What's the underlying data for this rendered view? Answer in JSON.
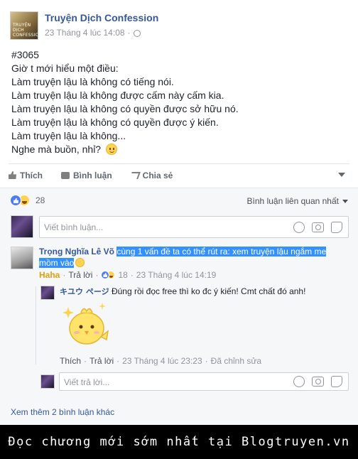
{
  "post": {
    "page_name": "Truyện Dịch Confession",
    "logo_text": "TRUYỆN DỊCH CONFESSION",
    "timestamp": "23 Tháng 4 lúc 14:08",
    "separator": "·",
    "lines": [
      "#3065",
      "Giờ t mới hiểu một điều:",
      "Làm truyện lậu là không có tiếng nói.",
      "Làm truyện lậu là không được cấm này cấm kia.",
      "Làm truyện lậu là không có quyền được sở hữu nó.",
      "Làm truyện lậu là không có quyền được ý kiến.",
      "Làm truyện lậu là không...",
      "Nghe mà buồn, nhỉ?"
    ]
  },
  "actions": {
    "like": "Thích",
    "comment": "Bình luận",
    "share": "Chia sẻ"
  },
  "reactions": {
    "count": "28",
    "sort_label": "Bình luận liên quan nhất"
  },
  "comment_input": {
    "placeholder": "Viết bình luận..."
  },
  "comment": {
    "author": "Trọng Nghĩa Lê Võ",
    "text_line1": "cùng 1 vấn đề ta có thể rút ra: xem truyện lậu ngắm me",
    "text_line2": "mồm vào",
    "reaction_label": "Haha",
    "reply_label": "Trả lời",
    "reaction_count": "18",
    "timestamp": "23 Tháng 4 lúc 14:19"
  },
  "reply": {
    "author": "キユウ ページ",
    "text": "Đúng rồi đọc free thì ko đc ý kiến! Cmt chất đó anh!",
    "like_label": "Thích",
    "reply_label": "Trả lời",
    "timestamp": "23 Tháng 4 lúc 23:23",
    "edited_label": "Đã chỉnh sửa"
  },
  "reply_input": {
    "placeholder": "Viết trả lời..."
  },
  "more_comments": "Xem thêm 2 bình luận khác",
  "banner": "Đọc chương mới sớm nhất tại Blogtruyen.vn",
  "colors": {
    "link_blue": "#365899",
    "highlight": "#3390ff",
    "haha_orange": "#e59d0d",
    "muted": "#90949c",
    "comment_bg": "#f6f7f9"
  }
}
